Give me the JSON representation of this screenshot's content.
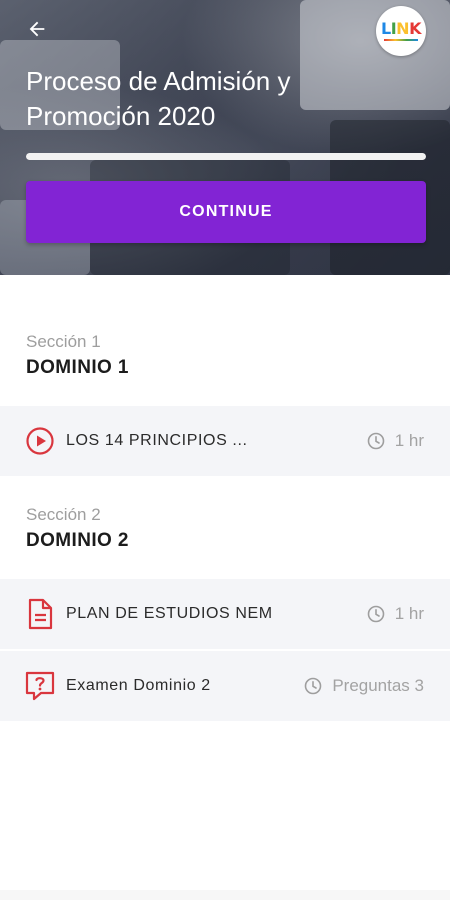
{
  "header": {
    "course_title": "Proceso de Admisión y Promoción 2020",
    "progress": 1.0,
    "continue_label": "CONTINUE",
    "logo_text": "LINK",
    "logo_colors": [
      "#1e88e5",
      "#43a047",
      "#fbc02d",
      "#e53935"
    ]
  },
  "sections": [
    {
      "label": "Sección 1",
      "title": "DOMINIO 1",
      "lessons": [
        {
          "icon": "play-circle-icon",
          "name": "LOS 14 PRINCIPIOS ...",
          "meta": "1 hr"
        }
      ]
    },
    {
      "label": "Sección 2",
      "title": "DOMINIO 2",
      "lessons": [
        {
          "icon": "document-icon",
          "name": "PLAN DE ESTUDIOS NEM",
          "meta": "1 hr"
        },
        {
          "icon": "question-bubble-icon",
          "name": "Examen Dominio 2",
          "meta": "Preguntas 3"
        }
      ]
    }
  ],
  "colors": {
    "accent": "#8224d4",
    "icon_red": "#d9363e",
    "row_bg": "#f4f5f8",
    "muted_text": "#9e9e9e"
  }
}
